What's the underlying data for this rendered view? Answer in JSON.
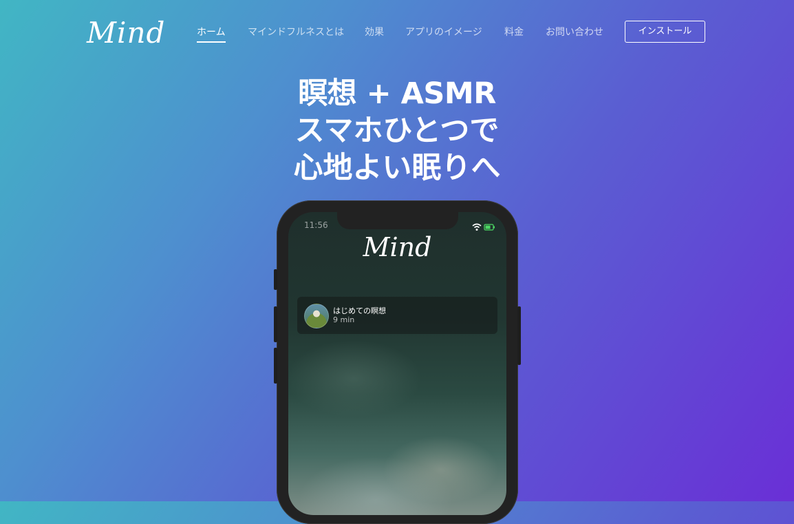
{
  "brand": {
    "logo": "Mind"
  },
  "nav": {
    "items": [
      {
        "label": "ホーム",
        "active": true
      },
      {
        "label": "マインドフルネスとは"
      },
      {
        "label": "効果"
      },
      {
        "label": "アプリのイメージ"
      },
      {
        "label": "料金"
      },
      {
        "label": "お問い合わせ"
      }
    ],
    "install_label": "インストール"
  },
  "hero": {
    "line1": "瞑想 + ASMR",
    "line2": "スマホひとつで",
    "line3": "心地よい眠りへ"
  },
  "phone": {
    "status_time": "11:56",
    "app_logo": "Mind",
    "card": {
      "title": "はじめての瞑想",
      "duration": "9 min"
    }
  },
  "colors": {
    "gradient_start": "#41b6c4",
    "gradient_end": "#6a2fd6",
    "battery": "#4cd964"
  }
}
